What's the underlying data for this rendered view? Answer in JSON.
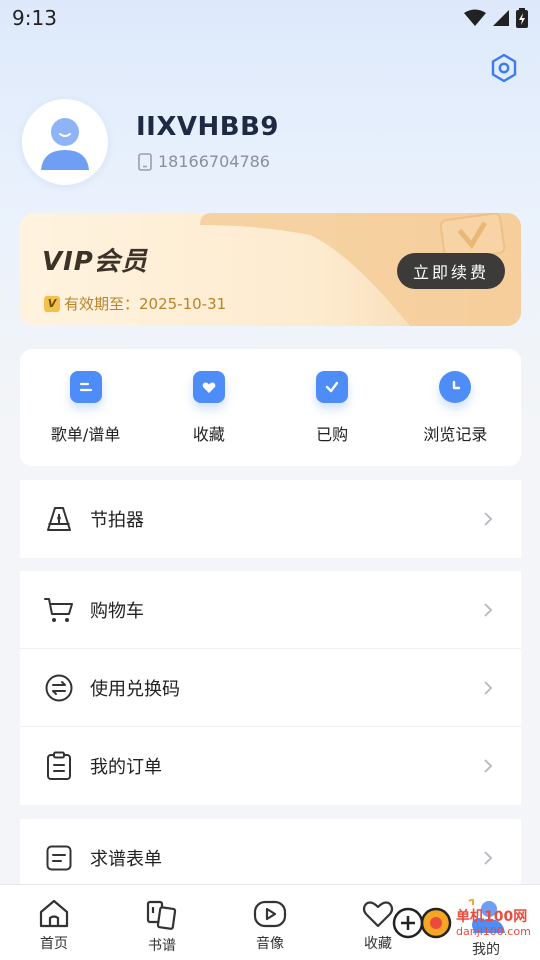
{
  "status_bar": {
    "time": "9:13"
  },
  "profile": {
    "username": "IIXVHBB9",
    "phone": "18166704786"
  },
  "vip": {
    "title": "VIP会员",
    "badge": "V",
    "expire_text": "有效期至：2025-10-31",
    "renew_label": "立即续费"
  },
  "quick_actions": [
    {
      "label": "歌单/谱单",
      "icon": "list-icon"
    },
    {
      "label": "收藏",
      "icon": "favorite-folder-icon"
    },
    {
      "label": "已购",
      "icon": "purchased-clipboard-icon"
    },
    {
      "label": "浏览记录",
      "icon": "history-clock-icon"
    }
  ],
  "menu": {
    "metronome": "节拍器",
    "cart": "购物车",
    "redeem": "使用兑换码",
    "orders": "我的订单",
    "request_form": "求谱表单"
  },
  "tabbar": [
    {
      "label": "首页",
      "icon": "home-icon"
    },
    {
      "label": "书谱",
      "icon": "books-icon"
    },
    {
      "label": "音像",
      "icon": "video-icon"
    },
    {
      "label": "收藏",
      "icon": "heart-icon"
    },
    {
      "label": "我的",
      "icon": "profile-icon"
    }
  ],
  "watermark": {
    "text": "单机100网",
    "sub": "danji100.com"
  },
  "colors": {
    "accent": "#4e8cf7",
    "vip_gold": "#b7842a",
    "renew_bg": "#3d3b3a"
  }
}
